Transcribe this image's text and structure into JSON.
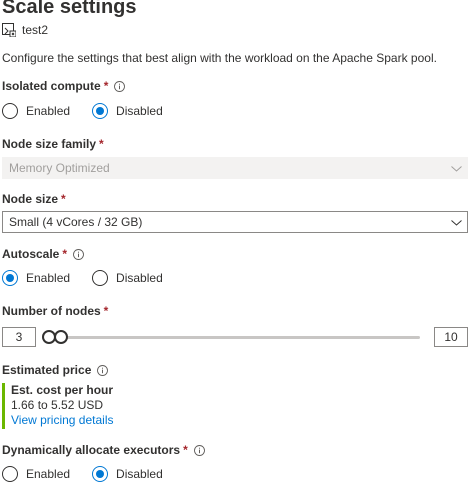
{
  "title": "Scale settings",
  "resource": {
    "name": "test2",
    "icon": "spark-pool-icon"
  },
  "description": "Configure the settings that best align with the workload on the Apache Spark pool.",
  "isolated_compute": {
    "label": "Isolated compute",
    "required_mark": "*",
    "options": [
      "Enabled",
      "Disabled"
    ],
    "selected": "Disabled"
  },
  "node_size_family": {
    "label": "Node size family",
    "required_mark": "*",
    "value": "Memory Optimized",
    "disabled": true
  },
  "node_size": {
    "label": "Node size",
    "required_mark": "*",
    "value": "Small (4 vCores / 32 GB)"
  },
  "autoscale": {
    "label": "Autoscale",
    "required_mark": "*",
    "options": [
      "Enabled",
      "Disabled"
    ],
    "selected": "Enabled"
  },
  "number_of_nodes": {
    "label": "Number of nodes",
    "required_mark": "*",
    "min_value": "3",
    "max_value": "10",
    "range_min": 3,
    "range_max": 200
  },
  "estimated_price": {
    "label": "Estimated price",
    "heading": "Est. cost per hour",
    "range": "1.66 to 5.52 USD",
    "link": "View pricing details",
    "accent_color": "#6bb700"
  },
  "dynamic_executors": {
    "label": "Dynamically allocate executors",
    "required_mark": "*",
    "options": [
      "Enabled",
      "Disabled"
    ],
    "selected": "Disabled"
  },
  "colors": {
    "accent": "#0078d4",
    "required": "#a4262c"
  }
}
